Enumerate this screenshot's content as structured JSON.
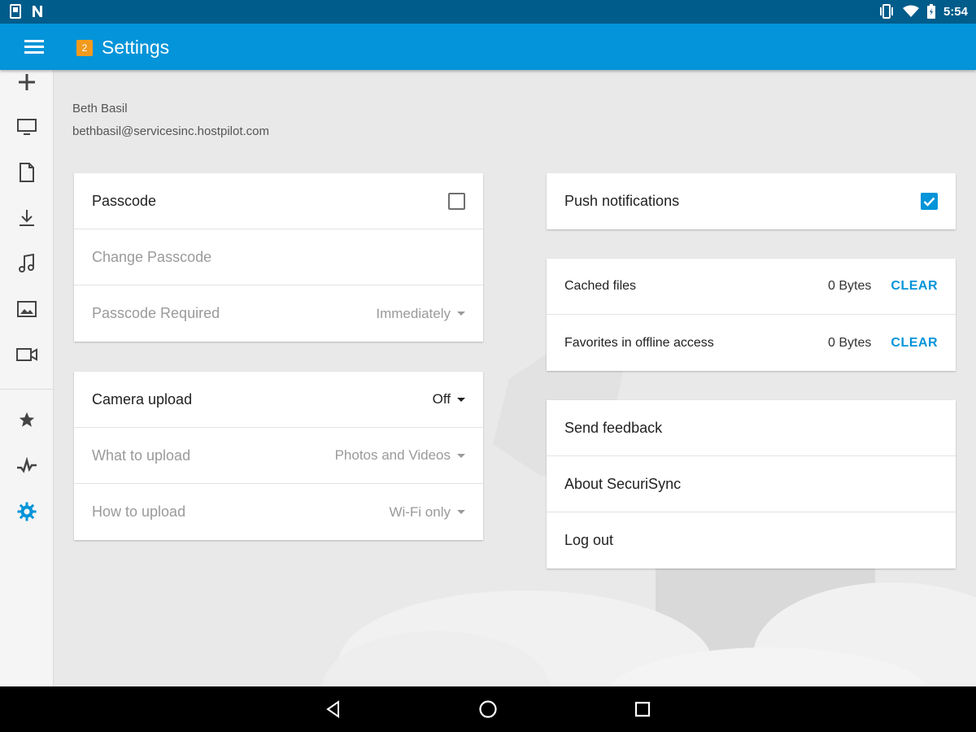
{
  "status_bar": {
    "time": "5:54",
    "left_icons": [
      "device-icon",
      "n-icon"
    ],
    "right_icons": [
      "vibrate-icon",
      "wifi-icon",
      "battery-icon"
    ]
  },
  "app_bar": {
    "title": "Settings",
    "logo_badge": "2",
    "accent_color": "#0394d9",
    "status_color": "#005c8a"
  },
  "rail": {
    "items": [
      {
        "icon": "plus-icon"
      },
      {
        "icon": "monitor-icon"
      },
      {
        "icon": "document-icon"
      },
      {
        "icon": "download-icon"
      },
      {
        "icon": "music-icon"
      },
      {
        "icon": "image-icon"
      },
      {
        "icon": "video-icon"
      },
      {
        "icon": "star-icon"
      },
      {
        "icon": "activity-icon"
      },
      {
        "icon": "gear-icon",
        "active": true
      }
    ]
  },
  "user": {
    "name": "Beth Basil",
    "email": "bethbasil@servicesinc.hostpilot.com"
  },
  "passcode_card": {
    "title": "Passcode",
    "enabled": false,
    "change_label": "Change Passcode",
    "required_label": "Passcode Required",
    "required_value": "Immediately"
  },
  "camera_card": {
    "title": "Camera upload",
    "value": "Off",
    "what_label": "What to upload",
    "what_value": "Photos and Videos",
    "how_label": "How to upload",
    "how_value": "Wi-Fi only"
  },
  "push_card": {
    "title": "Push notifications",
    "enabled": true
  },
  "storage_card": {
    "cached_label": "Cached files",
    "cached_size": "0 Bytes",
    "cached_action": "CLEAR",
    "favorites_label": "Favorites in offline access",
    "favorites_size": "0 Bytes",
    "favorites_action": "CLEAR"
  },
  "misc_card": {
    "feedback": "Send feedback",
    "about": "About SecuriSync",
    "logout": "Log out"
  },
  "nav_bar": {
    "icons": [
      "back-icon",
      "home-icon",
      "recents-icon"
    ]
  }
}
